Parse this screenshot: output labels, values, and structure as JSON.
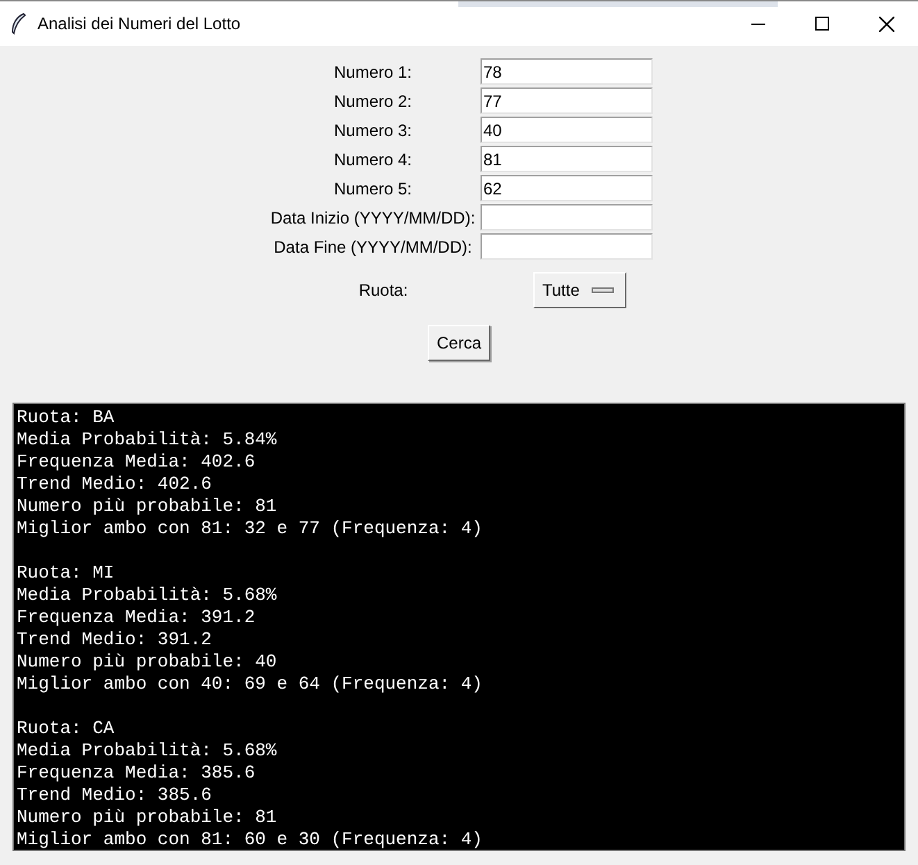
{
  "window": {
    "title": "Analisi dei Numeri del Lotto"
  },
  "fields": [
    {
      "label": "Numero 1:",
      "value": "78"
    },
    {
      "label": "Numero 2:",
      "value": "77"
    },
    {
      "label": "Numero 3:",
      "value": "40"
    },
    {
      "label": "Numero 4:",
      "value": "81"
    },
    {
      "label": "Numero 5:",
      "value": "62"
    },
    {
      "label": "Data Inizio (YYYY/MM/DD):"
    },
    {
      "label": "Data Fine (YYYY/MM/DD):"
    }
  ],
  "ruota": {
    "label": "Ruota:",
    "value": "Tutte"
  },
  "search_button": "Cerca",
  "output": [
    [
      "Ruota: BA",
      "Media Probabilità: 5.84%",
      "Frequenza Media: 402.6",
      "Trend Medio: 402.6",
      "Numero più probabile: 81",
      "Miglior ambo con 81: 32 e 77 (Frequenza: 4)"
    ],
    [
      "Ruota: MI",
      "Media Probabilità: 5.68%",
      "Frequenza Media: 391.2",
      "Trend Medio: 391.2",
      "Numero più probabile: 40",
      "Miglior ambo con 40: 69 e 64 (Frequenza: 4)"
    ],
    [
      "Ruota: CA",
      "Media Probabilità: 5.68%",
      "Frequenza Media: 385.6",
      "Trend Medio: 385.6",
      "Numero più probabile: 81",
      "Miglior ambo con 81: 60 e 30 (Frequenza: 4)"
    ]
  ]
}
